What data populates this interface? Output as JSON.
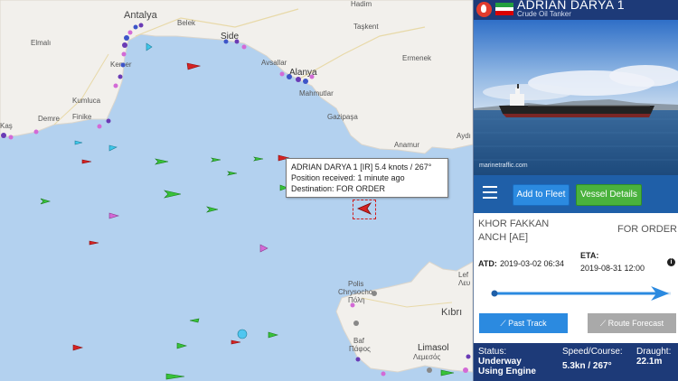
{
  "map": {
    "places": {
      "antalya": "Antalya",
      "belek": "Belek",
      "side": "Side",
      "hadim": "Hadim",
      "taskent": "Taşkent",
      "elmali": "Elmalı",
      "kemer": "Kemer",
      "avsallar": "Avsallar",
      "ermenek": "Ermenek",
      "alanya": "Alanya",
      "mahmutlar": "Mahmutlar",
      "kumluca": "Kumluca",
      "demre": "Demre",
      "finike": "Finike",
      "kas": "Kaş",
      "gazipasa": "Gazipaşa",
      "anamur": "Anamur",
      "aydincik": "Aydı",
      "polis": "Polis",
      "chrysochou": "Chrysocho",
      "polis_gr": "Πόλη",
      "lefkosa": "Lef",
      "lefkosa2": "Λευ",
      "kibris": "Kıbrı",
      "baf": "Baf",
      "pafos": "Πάφος",
      "limasol": "Limasol",
      "lemesos": "Λεμεσός"
    },
    "tooltip": {
      "line1": "ADRIAN DARYA 1 [IR] 5.4 knots / 267°",
      "line2": "Position received: 1 minute ago",
      "line3": "Destination: FOR ORDER"
    }
  },
  "vessel": {
    "name": "ADRIAN DARYA 1",
    "type": "Crude Oil Tanker",
    "photo_credit": "marinetraffic.com",
    "flag_colors": [
      "#239f40",
      "#ffffff",
      "#da0000"
    ]
  },
  "toolbar": {
    "add_to_fleet": "Add to Fleet",
    "vessel_details": "Vessel Details"
  },
  "route": {
    "from_line1": "KHOR FAKKAN",
    "from_line2": "ANCH [AE]",
    "to": "FOR ORDER"
  },
  "times": {
    "atd_label": "ATD:",
    "atd_value": "2019-03-02 06:34",
    "eta_label": "ETA:",
    "eta_value": "2019-08-31 12:00",
    "info": "i"
  },
  "progress": {
    "fraction": 0.97
  },
  "actions": {
    "past_track": "Past Track",
    "route_forecast": "Route Forecast"
  },
  "status": {
    "status_label": "Status:",
    "status_value_1": "Underway",
    "status_value_2": "Using Engine",
    "speed_label": "Speed/Course:",
    "speed_value": "5.3kn / 267°",
    "draught_label": "Draught:",
    "draught_value": "22.1m"
  },
  "colors": {
    "header": "#1d3a78",
    "toolbar": "#1f5fa8",
    "fleet_button": "#2b8ae0",
    "details_button": "#4ab23d",
    "sea": "#b3d1ef",
    "land": "#f2f0ec"
  }
}
